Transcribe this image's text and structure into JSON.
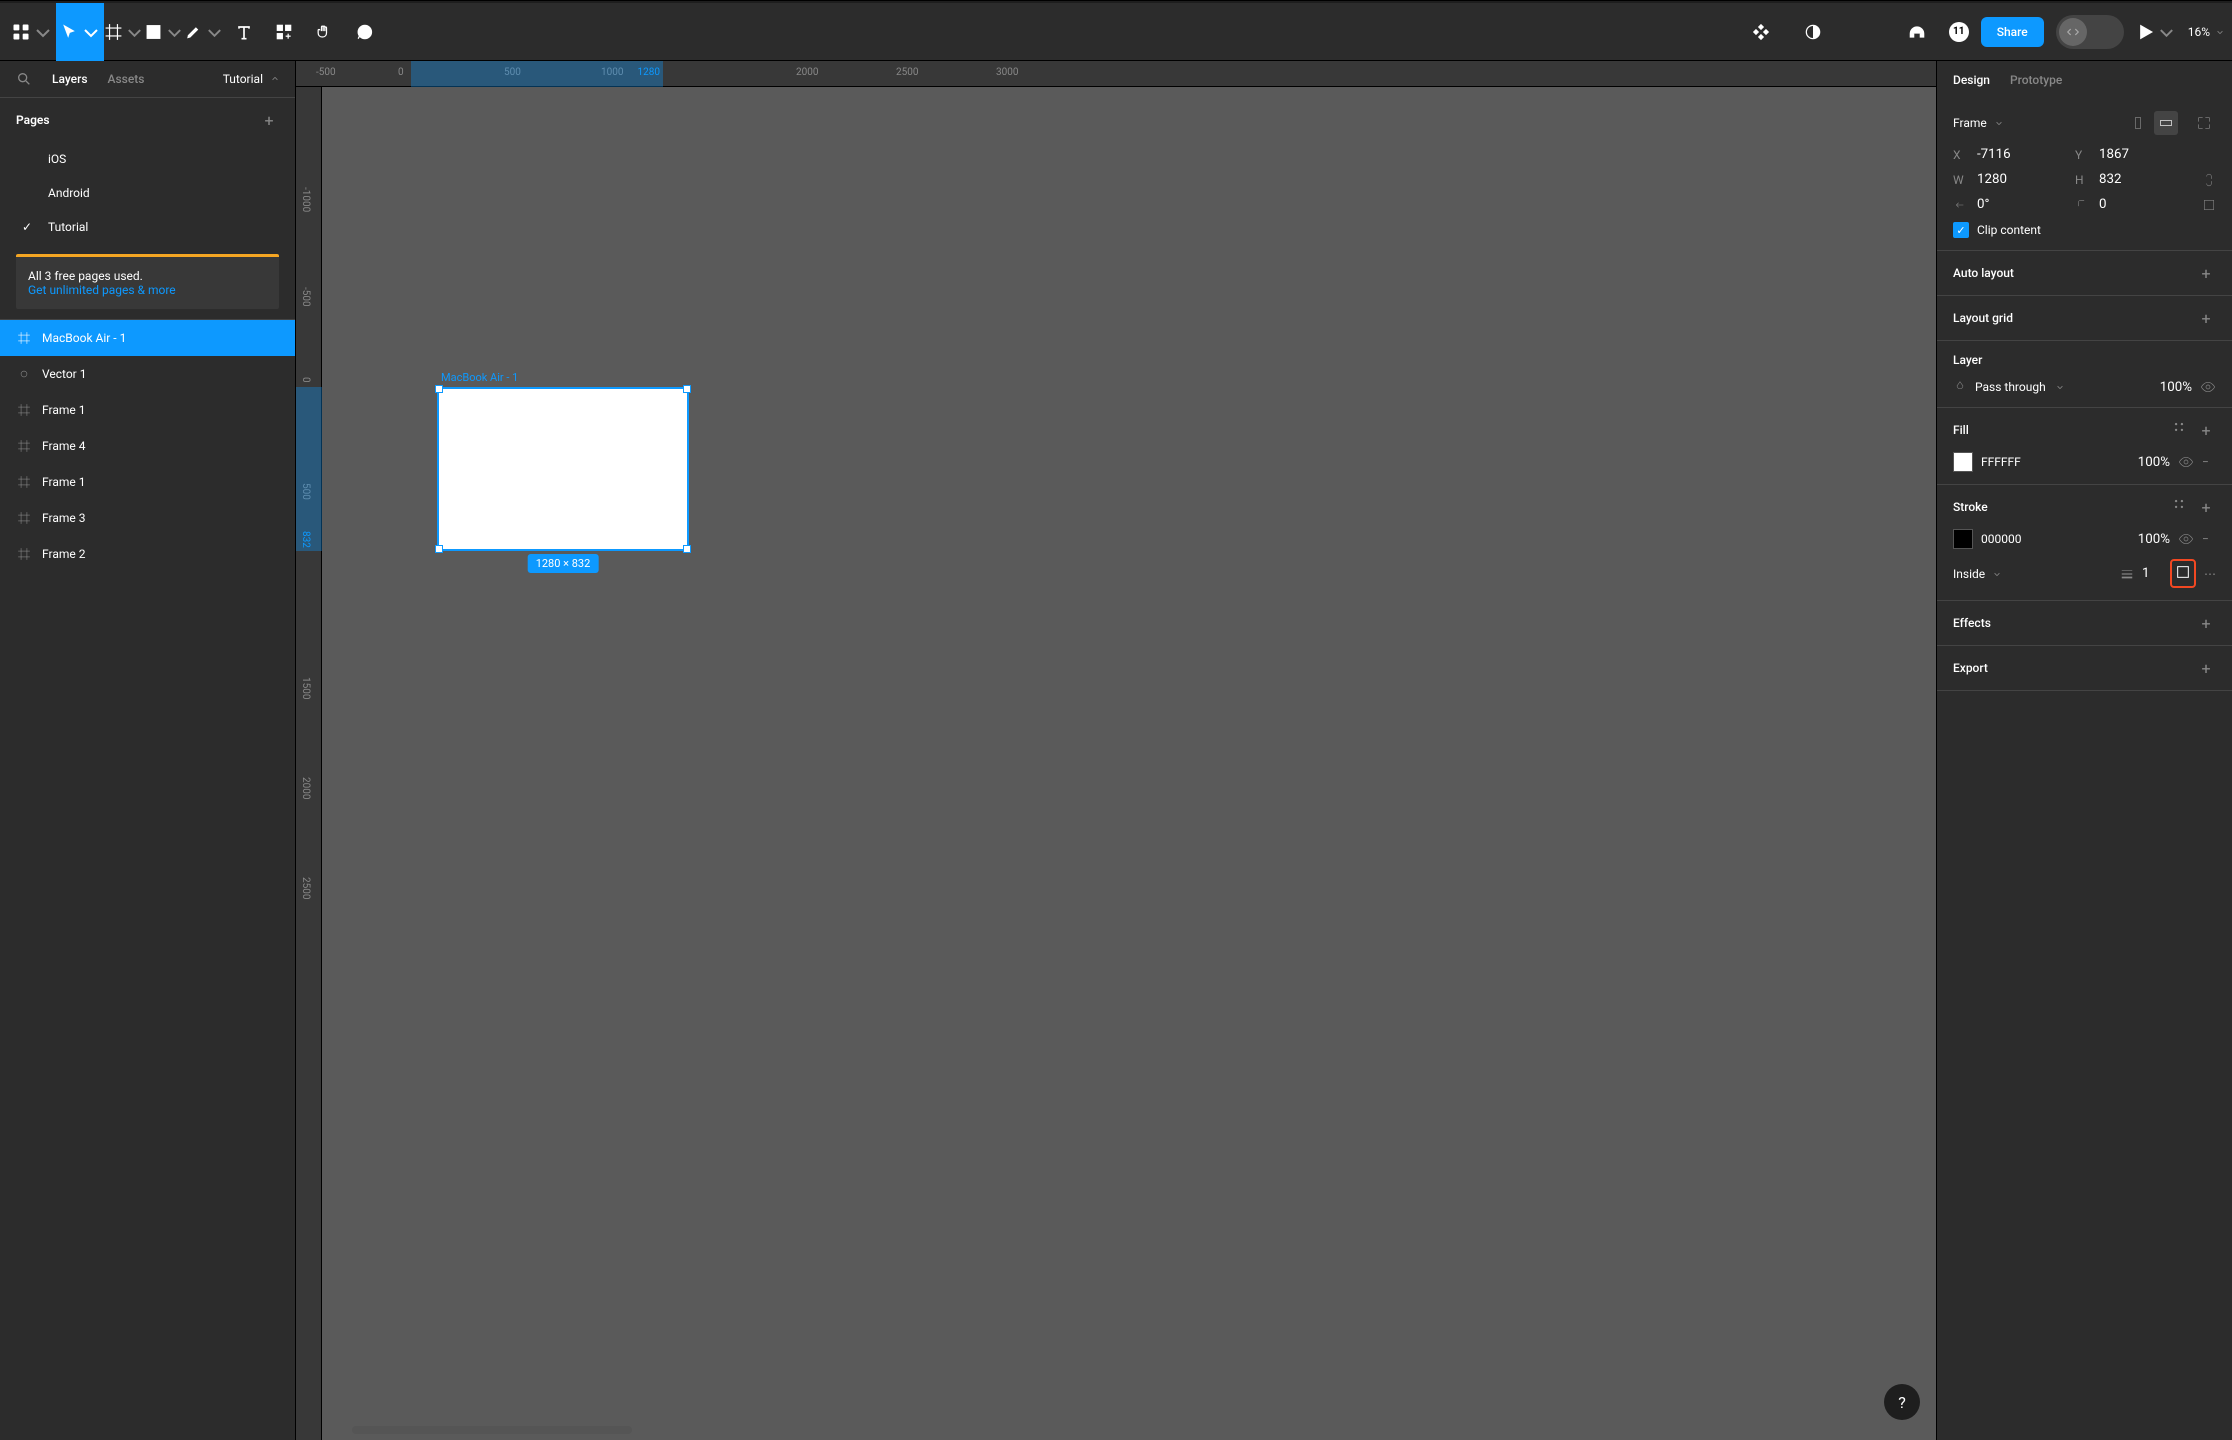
{
  "toolbar": {
    "share_label": "Share"
  },
  "zoom_level": "16%",
  "notification_count": "11",
  "left_panel": {
    "tabs": [
      "Layers",
      "Assets"
    ],
    "tutorial_label": "Tutorial",
    "pages_title": "Pages",
    "pages": [
      "iOS",
      "Android",
      "Tutorial"
    ],
    "notice_line1": "All 3 free pages used.",
    "notice_link": "Get unlimited pages & more",
    "layers": [
      {
        "name": "MacBook Air - 1",
        "type": "frame"
      },
      {
        "name": "Vector 1",
        "type": "vector"
      },
      {
        "name": "Frame 1",
        "type": "frame"
      },
      {
        "name": "Frame 4",
        "type": "frame"
      },
      {
        "name": "Frame 1",
        "type": "frame"
      },
      {
        "name": "Frame 3",
        "type": "frame"
      },
      {
        "name": "Frame 2",
        "type": "frame"
      }
    ]
  },
  "canvas": {
    "frame_label": "MacBook Air - 1",
    "frame_size": "1280 × 832",
    "ruler_h": [
      "-500",
      "0",
      "500",
      "1000",
      "1280",
      "2000",
      "2500",
      "3000"
    ],
    "ruler_h_sel_start": "1280",
    "ruler_v": [
      "-1000",
      "-500",
      "0",
      "500",
      "832",
      "1500",
      "2000",
      "2500"
    ],
    "ruler_v_sel": "832"
  },
  "right_panel": {
    "tabs": [
      "Design",
      "Prototype"
    ],
    "frame_label": "Frame",
    "x_label": "X",
    "x_val": "-7116",
    "y_label": "Y",
    "y_val": "1867",
    "w_label": "W",
    "w_val": "1280",
    "h_label": "H",
    "h_val": "832",
    "rotation": "0°",
    "corner_radius": "0",
    "clip_label": "Clip content",
    "auto_layout_label": "Auto layout",
    "layout_grid_label": "Layout grid",
    "layer_label": "Layer",
    "blend_mode": "Pass through",
    "layer_opacity": "100%",
    "fill_label": "Fill",
    "fill_hex": "FFFFFF",
    "fill_opacity": "100%",
    "stroke_label": "Stroke",
    "stroke_hex": "000000",
    "stroke_opacity": "100%",
    "stroke_position": "Inside",
    "stroke_weight": "1",
    "effects_label": "Effects",
    "export_label": "Export"
  }
}
